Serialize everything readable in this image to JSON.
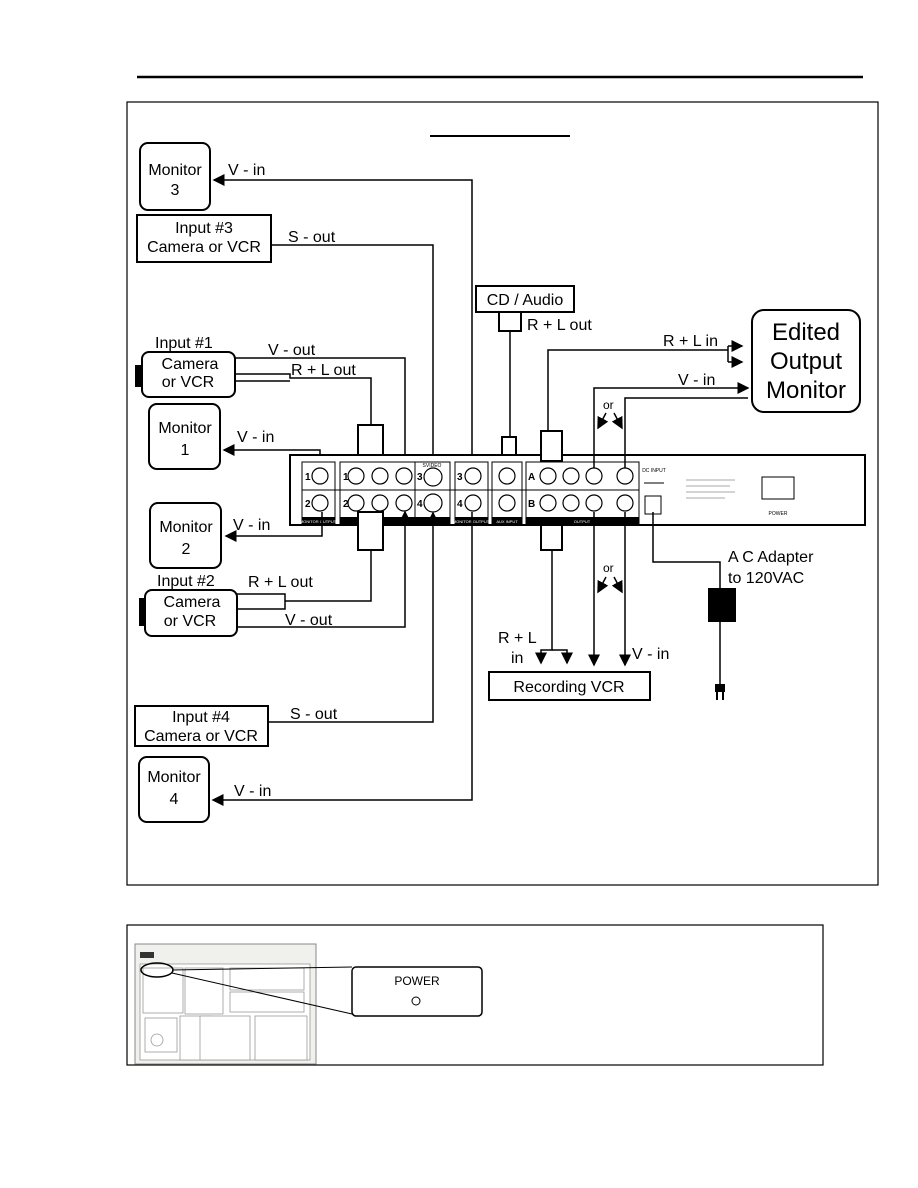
{
  "diagram": {
    "monitor3": {
      "line1": "Monitor",
      "line2": "3",
      "conn": "V - in"
    },
    "input3": {
      "line1": "Input  #3",
      "line2": "Camera or VCR",
      "conn": "S - out"
    },
    "cd_audio": {
      "label": "CD / Audio",
      "conn": "R + L out"
    },
    "input1": {
      "title": "Input  #1",
      "line1": "Camera",
      "line2": "or VCR",
      "video": "V - out",
      "audio": "R + L out"
    },
    "monitor1": {
      "line1": "Monitor",
      "line2": "1",
      "conn": "V - in"
    },
    "monitor2": {
      "line1": "Monitor",
      "line2": "2",
      "conn": "V - in"
    },
    "input2": {
      "title": "Input  #2",
      "line1": "Camera",
      "line2": "or VCR",
      "audio": "R + L out",
      "video": "V - out"
    },
    "input4": {
      "line1": "Input  #4",
      "line2": "Camera or VCR",
      "conn": "S - out"
    },
    "monitor4": {
      "line1": "Monitor",
      "line2": "4",
      "conn": "V - in"
    },
    "edited_monitor": {
      "line1": "Edited",
      "line2": "Output",
      "line3": "Monitor",
      "audio": "R + L in",
      "video": "V - in",
      "or": "or"
    },
    "recording_vcr": {
      "label": "Recording VCR",
      "audio1": "R + L",
      "audio2": "in",
      "video": "V - in",
      "or": "or"
    },
    "ac_adapter": {
      "line1": "A C  Adapter",
      "line2": "to 120VAC"
    },
    "rear_panel": {
      "monitor_output": "MONITOR OUTPUT",
      "input": "INPUT",
      "svideo": "SVIDEO",
      "aux_input": "AUX INPUT",
      "output": "OUTPUT",
      "dc_input": "DC INPUT",
      "power": "POWER",
      "n1": "1",
      "n2": "2",
      "n3": "3",
      "n4": "4",
      "a": "A",
      "b": "B"
    }
  },
  "power_callout": {
    "label": "POWER"
  }
}
